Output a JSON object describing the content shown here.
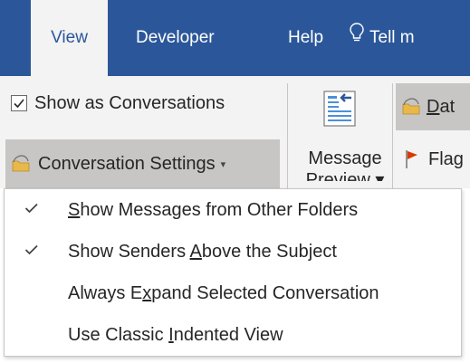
{
  "tabs": {
    "view": "View",
    "developer": "Developer",
    "help": "Help",
    "tell_me": "Tell m"
  },
  "ribbon": {
    "show_as_conversations": "Show as Conversations",
    "conversation_settings": "Conversation Settings",
    "message_preview_line1": "Message",
    "message_preview_line2": "Preview",
    "date_prefix": "D",
    "date_rest": "at",
    "flag_label": "Flag"
  },
  "menu": {
    "items": [
      {
        "checked": true,
        "pre": "",
        "ul": "S",
        "post": "how Messages from Other Folders"
      },
      {
        "checked": true,
        "pre": "Show Senders ",
        "ul": "A",
        "post": "bove the Subject"
      },
      {
        "checked": false,
        "pre": "Always E",
        "ul": "x",
        "post": "pand Selected Conversation"
      },
      {
        "checked": false,
        "pre": "Use Classic ",
        "ul": "I",
        "post": "ndented View"
      }
    ]
  },
  "colors": {
    "tab_bar": "#2b579a",
    "ribbon_bg": "#f3f3f3",
    "hover": "#c8c6c4",
    "flag": "#d83b01"
  }
}
